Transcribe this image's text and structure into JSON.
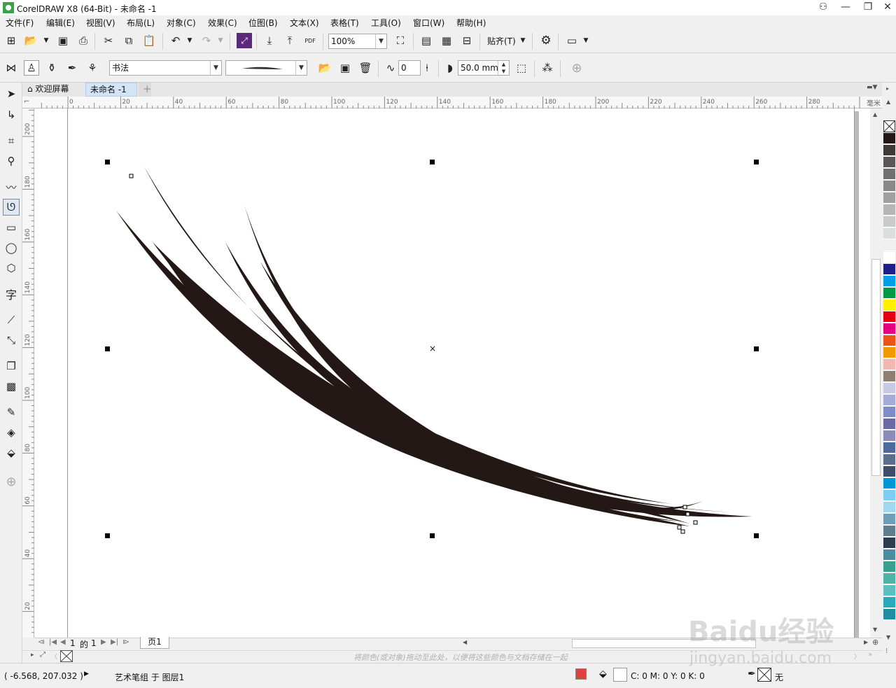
{
  "window": {
    "title": "CorelDRAW X8 (64-Bit) - 未命名 -1",
    "minimize": "—",
    "restore": "❐",
    "close": "✕"
  },
  "menu": [
    "文件(F)",
    "编辑(E)",
    "视图(V)",
    "布局(L)",
    "对象(C)",
    "效果(C)",
    "位图(B)",
    "文本(X)",
    "表格(T)",
    "工具(O)",
    "窗口(W)",
    "帮助(H)"
  ],
  "toolbar": {
    "zoom_value": "100%",
    "snap_label": "贴齐(T)",
    "pdf_label": "PDF"
  },
  "property_bar": {
    "preset_value": "书法",
    "smoothing_value": "0",
    "width_value": "50.0 mm"
  },
  "tabs": {
    "welcome": "欢迎屏幕",
    "document": "未命名 -1",
    "add": "+"
  },
  "ruler": {
    "units": "毫米",
    "horizontal_ticks": [
      "0",
      "20",
      "40",
      "60",
      "80",
      "100",
      "120",
      "140",
      "160",
      "180",
      "200",
      "220",
      "240",
      "260",
      "280"
    ],
    "vertical_ticks": [
      "200",
      "180",
      "160",
      "140",
      "120",
      "100",
      "80",
      "60",
      "40",
      "20"
    ]
  },
  "page_nav": {
    "current": "1",
    "of_label": "的",
    "total": "1",
    "page_tab": "页1"
  },
  "doc_palette_hint": "将颜色(或对象)拖动至此处，以便将这些颜色与文档存储在一起",
  "status": {
    "coordinates": "( -6.568, 207.032 )",
    "object_info": "艺术笔组 于 图层1",
    "fill_info": "C: 0 M: 0 Y: 0 K: 0",
    "outline_info": "无"
  },
  "palette_colors": [
    "#231815",
    "#3e3a39",
    "#595757",
    "#727171",
    "#898989",
    "#9fa0a0",
    "#b5b5b6",
    "#c9caca",
    "#dcdddd",
    "#efefef",
    "#ffffff",
    "#1d2088",
    "#00a0e9",
    "#009944",
    "#fff100",
    "#e60012",
    "#e4007f",
    "#ea5514",
    "#f39800",
    "#f2b7b1",
    "#8f7f70",
    "#c8c9e4",
    "#a3acd9",
    "#7e8cc8",
    "#6a6aa7",
    "#8c8ab9",
    "#4c6a9b",
    "#5a6f8c",
    "#3f4d6b",
    "#0097d8",
    "#7ecef4",
    "#a0d8ef",
    "#6f9fb8",
    "#5f7f8f",
    "#2b3d4f",
    "#4c8c9f",
    "#3a9f8f",
    "#4fb4a6",
    "#5bc0c0",
    "#29a9b9",
    "#1f8fa0"
  ],
  "watermark": {
    "brand": "Baidu经验",
    "url": "jingyan.baidu.com"
  }
}
